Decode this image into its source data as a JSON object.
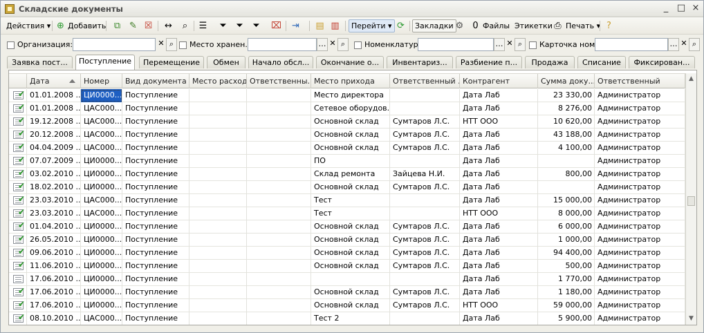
{
  "window": {
    "title": "Складские документы",
    "controls": [
      "_",
      "□",
      "×"
    ]
  },
  "toolbar": {
    "actions_label": "Действия",
    "add_label": "Добавить",
    "goto_label": "Перейти",
    "bookmarks_label": "Закладки",
    "files_label": "Файлы",
    "labels_label": "Этикетки",
    "print_label": "Печать"
  },
  "filters": {
    "organization_label": "Организация:",
    "storage_label": "Место хранен...",
    "nomenclature_label": "Номенклатура:",
    "card_label": "Карточка ном..."
  },
  "tabs": [
    {
      "label": "Заявка пост..."
    },
    {
      "label": "Поступление",
      "active": true
    },
    {
      "label": "Перемещение"
    },
    {
      "label": "Обмен"
    },
    {
      "label": "Начало обсл..."
    },
    {
      "label": "Окончание о..."
    },
    {
      "label": "Инвентариз..."
    },
    {
      "label": "Разбиение п..."
    },
    {
      "label": "Продажа"
    },
    {
      "label": "Списание"
    },
    {
      "label": "Фиксирован..."
    }
  ],
  "table": {
    "columns": [
      "Дата",
      "Номер",
      "Вид документа",
      "Место расхода",
      "Ответственны...",
      "Место прихода",
      "Ответственный ...",
      "Контрагент",
      "Сумма доку...",
      "Ответственный"
    ],
    "rows": [
      {
        "posted": true,
        "date": "01.01.2008 ...",
        "number": "ЦИ0000...",
        "kind": "Поступление",
        "from": "",
        "resp_from": "",
        "to": "Место директора",
        "resp_to": "",
        "contractor": "Дата Лаб",
        "sum": "23 330,00",
        "resp": "Администратор"
      },
      {
        "posted": true,
        "date": "01.01.2008 ...",
        "number": "ЦАС000...",
        "kind": "Поступление",
        "from": "",
        "resp_from": "",
        "to": "Сетевое оборудов...",
        "resp_to": "",
        "contractor": "Дата Лаб",
        "sum": "8 276,00",
        "resp": "Администратор"
      },
      {
        "posted": true,
        "date": "19.12.2008 ...",
        "number": "ЦАС000...",
        "kind": "Поступление",
        "from": "",
        "resp_from": "",
        "to": "Основной склад",
        "resp_to": "Сумтаров Л.С.",
        "contractor": "НТТ ООО",
        "sum": "10 620,00",
        "resp": "Администратор"
      },
      {
        "posted": true,
        "date": "20.12.2008 ...",
        "number": "ЦАС000...",
        "kind": "Поступление",
        "from": "",
        "resp_from": "",
        "to": "Основной склад",
        "resp_to": "Сумтаров Л.С.",
        "contractor": "Дата Лаб",
        "sum": "43 188,00",
        "resp": "Администратор"
      },
      {
        "posted": true,
        "date": "04.04.2009 ...",
        "number": "ЦАС000...",
        "kind": "Поступление",
        "from": "",
        "resp_from": "",
        "to": "Основной склад",
        "resp_to": "Сумтаров Л.С.",
        "contractor": "Дата Лаб",
        "sum": "4 100,00",
        "resp": "Администратор"
      },
      {
        "posted": true,
        "date": "07.07.2009 ...",
        "number": "ЦИ0000...",
        "kind": "Поступление",
        "from": "",
        "resp_from": "",
        "to": "ПО",
        "resp_to": "",
        "contractor": "Дата Лаб",
        "sum": "",
        "resp": "Администратор"
      },
      {
        "posted": true,
        "date": "03.02.2010 ...",
        "number": "ЦИ0000...",
        "kind": "Поступление",
        "from": "",
        "resp_from": "",
        "to": "Склад ремонта",
        "resp_to": "Зайцева Н.И.",
        "contractor": "Дата Лаб",
        "sum": "800,00",
        "resp": "Администратор"
      },
      {
        "posted": true,
        "date": "18.02.2010 ...",
        "number": "ЦИ0000...",
        "kind": "Поступление",
        "from": "",
        "resp_from": "",
        "to": "Основной склад",
        "resp_to": "Сумтаров Л.С.",
        "contractor": "Дата Лаб",
        "sum": "",
        "resp": "Администратор"
      },
      {
        "posted": true,
        "date": "23.03.2010 ...",
        "number": "ЦАС000...",
        "kind": "Поступление",
        "from": "",
        "resp_from": "",
        "to": "Тест",
        "resp_to": "",
        "contractor": "Дата Лаб",
        "sum": "15 000,00",
        "resp": "Администратор"
      },
      {
        "posted": true,
        "date": "23.03.2010 ...",
        "number": "ЦАС000...",
        "kind": "Поступление",
        "from": "",
        "resp_from": "",
        "to": "Тест",
        "resp_to": "",
        "contractor": "НТТ ООО",
        "sum": "8 000,00",
        "resp": "Администратор"
      },
      {
        "posted": true,
        "date": "01.04.2010 ...",
        "number": "ЦИ0000...",
        "kind": "Поступление",
        "from": "",
        "resp_from": "",
        "to": "Основной склад",
        "resp_to": "Сумтаров Л.С.",
        "contractor": "Дата Лаб",
        "sum": "6 000,00",
        "resp": "Администратор"
      },
      {
        "posted": true,
        "date": "26.05.2010 ...",
        "number": "ЦИ0000...",
        "kind": "Поступление",
        "from": "",
        "resp_from": "",
        "to": "Основной склад",
        "resp_to": "Сумтаров Л.С.",
        "contractor": "Дата Лаб",
        "sum": "1 000,00",
        "resp": "Администратор"
      },
      {
        "posted": true,
        "date": "09.06.2010 ...",
        "number": "ЦИ0000...",
        "kind": "Поступление",
        "from": "",
        "resp_from": "",
        "to": "Основной склад",
        "resp_to": "Сумтаров Л.С.",
        "contractor": "Дата Лаб",
        "sum": "94 400,00",
        "resp": "Администратор"
      },
      {
        "posted": true,
        "date": "11.06.2010 ...",
        "number": "ЦИ0000...",
        "kind": "Поступление",
        "from": "",
        "resp_from": "",
        "to": "Основной склад",
        "resp_to": "Сумтаров Л.С.",
        "contractor": "Дата Лаб",
        "sum": "500,00",
        "resp": "Администратор"
      },
      {
        "posted": false,
        "date": "17.06.2010 ...",
        "number": "ЦИ0000...",
        "kind": "Поступление",
        "from": "",
        "resp_from": "",
        "to": "",
        "resp_to": "",
        "contractor": "Дата Лаб",
        "sum": "1 770,00",
        "resp": "Администратор"
      },
      {
        "posted": true,
        "date": "17.06.2010 ...",
        "number": "ЦИ0000...",
        "kind": "Поступление",
        "from": "",
        "resp_from": "",
        "to": "Основной склад",
        "resp_to": "Сумтаров Л.С.",
        "contractor": "Дата Лаб",
        "sum": "1 180,00",
        "resp": "Администратор"
      },
      {
        "posted": true,
        "date": "17.06.2010 ...",
        "number": "ЦИ0000...",
        "kind": "Поступление",
        "from": "",
        "resp_from": "",
        "to": "Основной склад",
        "resp_to": "Сумтаров Л.С.",
        "contractor": "НТТ ООО",
        "sum": "59 000,00",
        "resp": "Администратор"
      },
      {
        "posted": true,
        "date": "08.10.2010 ...",
        "number": "ЦАС000...",
        "kind": "Поступление",
        "from": "",
        "resp_from": "",
        "to": "Тест 2",
        "resp_to": "",
        "contractor": "Дата Лаб",
        "sum": "5 900,00",
        "resp": "Администратор"
      }
    ]
  }
}
